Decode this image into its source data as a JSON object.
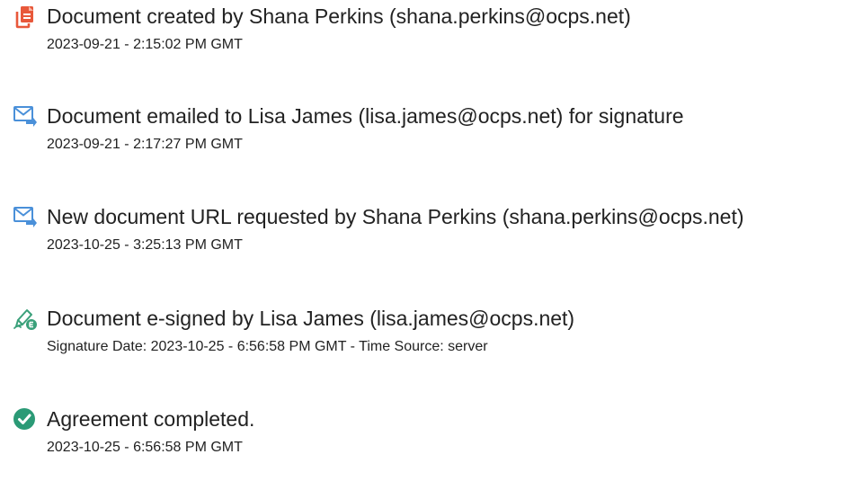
{
  "events": [
    {
      "icon": "document-created-icon",
      "title": "Document created by Shana Perkins (shana.perkins@ocps.net)",
      "meta": "2023-09-21 - 2:15:02 PM GMT"
    },
    {
      "icon": "email-sent-icon",
      "title": "Document emailed to Lisa James (lisa.james@ocps.net) for signature",
      "meta": "2023-09-21 - 2:17:27 PM GMT"
    },
    {
      "icon": "email-sent-icon",
      "title": "New document URL requested by Shana Perkins (shana.perkins@ocps.net)",
      "meta": "2023-10-25 - 3:25:13 PM GMT"
    },
    {
      "icon": "esign-pen-icon",
      "title": "Document e-signed by Lisa James (lisa.james@ocps.net)",
      "meta": "Signature Date: 2023-10-25 - 6:56:58 PM GMT - Time Source: server"
    },
    {
      "icon": "checkmark-circle-icon",
      "title": "Agreement completed.",
      "meta": "2023-10-25 - 6:56:58 PM GMT"
    }
  ],
  "colors": {
    "document_icon": "#e8583a",
    "email_icon": "#4a90d9",
    "esign_icon": "#3aa07a",
    "check_icon": "#2b9a76",
    "text": "#222222"
  }
}
